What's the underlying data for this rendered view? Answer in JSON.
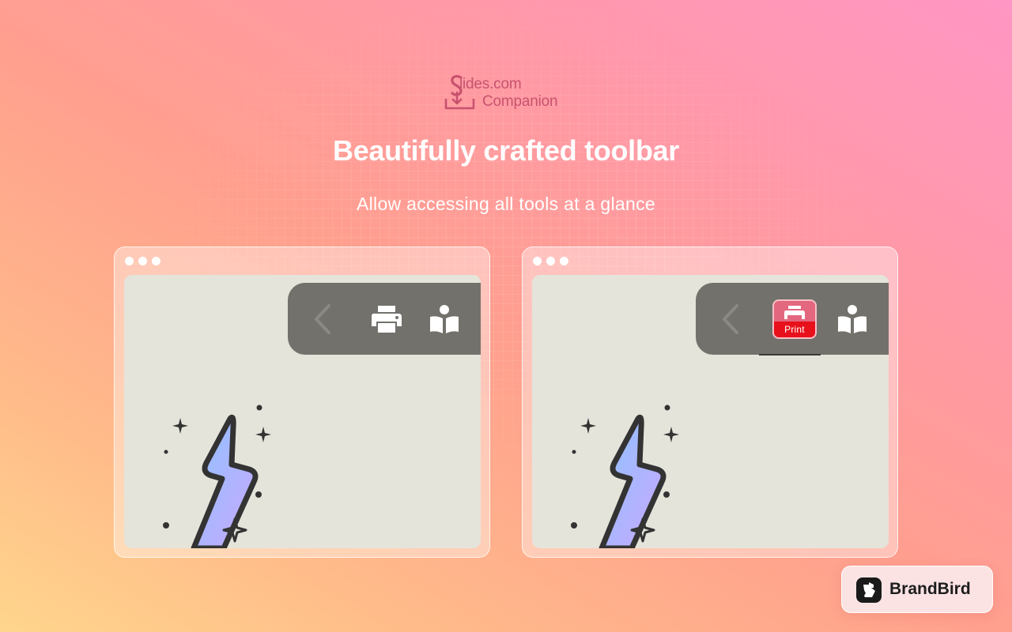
{
  "logo": {
    "line1": "lides.com",
    "line2": "Companion"
  },
  "headline": "Beautifully crafted toolbar",
  "subline": "Allow accessing all tools at a glance",
  "mockups": [
    {
      "state": "default",
      "toolbar": {
        "buttons": [
          "back",
          "print",
          "reader"
        ]
      }
    },
    {
      "state": "print-hovered",
      "toolbar": {
        "buttons": [
          "back",
          "print",
          "reader"
        ],
        "active_label": "Print"
      }
    }
  ],
  "badge": {
    "label": "BrandBird"
  },
  "colors": {
    "toolbar": "#72716b",
    "canvas": "#e5e4da",
    "print_active_top": "#e3677e",
    "print_active_bottom": "#e8101a",
    "logo": "#c8526e"
  }
}
